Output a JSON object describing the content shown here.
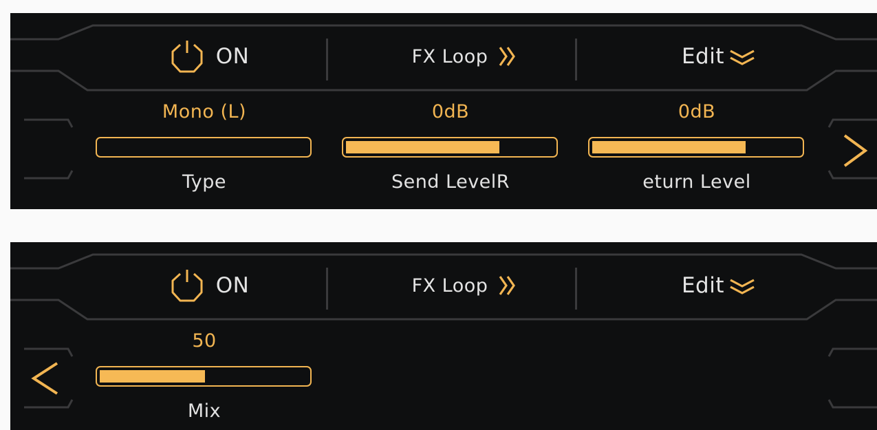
{
  "colors": {
    "accent": "#f2b552",
    "panel_bg": "#0e0f10",
    "frame": "#3a3a3c",
    "text": "#e4e4e4"
  },
  "pages": [
    {
      "header": {
        "power_icon": "power-icon",
        "power_label": "ON",
        "effect_label": "FX Loop",
        "effect_icon": "double-chevron-right-icon",
        "edit_label": "Edit",
        "edit_icon": "double-chevron-down-icon"
      },
      "params": [
        {
          "value": "Mono (L)",
          "level": 0.0,
          "label": "Type"
        },
        {
          "value": "0dB",
          "level": 0.73,
          "label": "Send LevelR"
        },
        {
          "value": "0dB",
          "level": 0.73,
          "label": "eturn Level"
        }
      ],
      "nav": {
        "next_icon": "chevron-right-icon"
      }
    },
    {
      "header": {
        "power_icon": "power-icon",
        "power_label": "ON",
        "effect_label": "FX Loop",
        "effect_icon": "double-chevron-right-icon",
        "edit_label": "Edit",
        "edit_icon": "double-chevron-down-icon"
      },
      "params": [
        {
          "value": "50",
          "level": 0.5,
          "label": "Mix"
        }
      ],
      "nav": {
        "prev_icon": "chevron-left-icon"
      }
    }
  ]
}
